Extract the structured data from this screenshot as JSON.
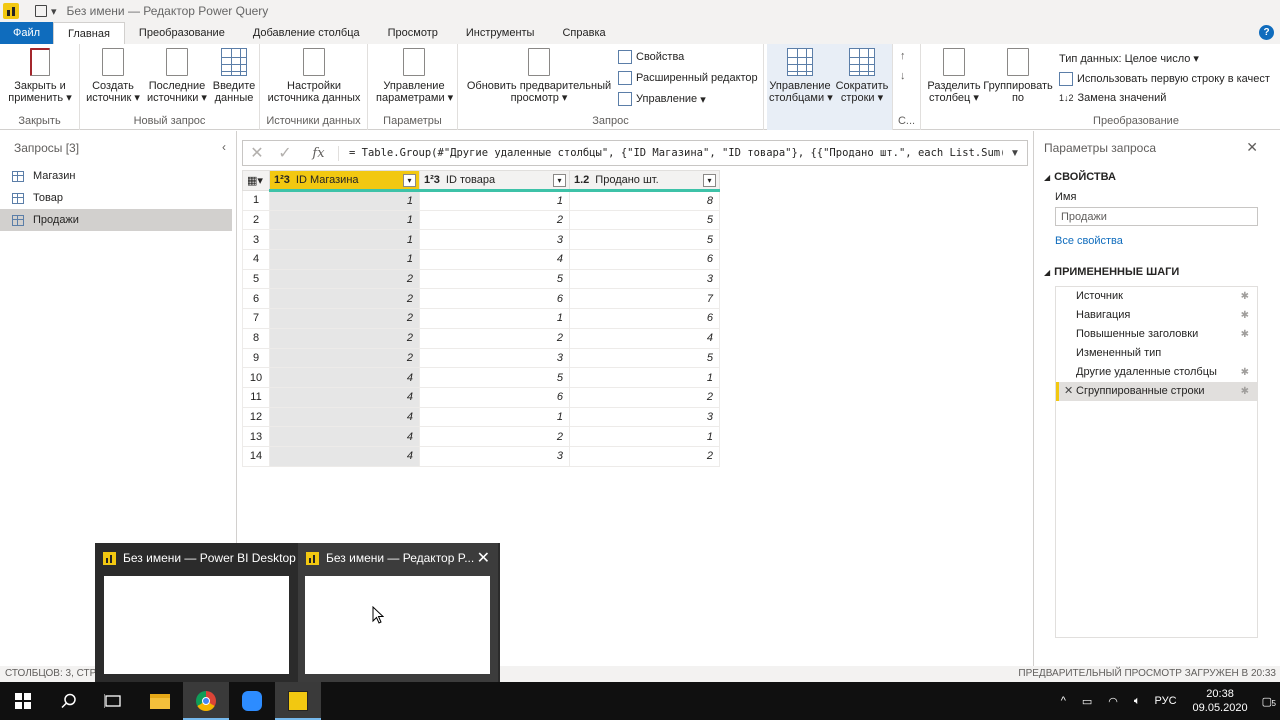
{
  "window": {
    "title": "Без имени — Редактор Power Query"
  },
  "tabs": [
    {
      "label": "Файл"
    },
    {
      "label": "Главная"
    },
    {
      "label": "Преобразование"
    },
    {
      "label": "Добавление столбца"
    },
    {
      "label": "Просмотр"
    },
    {
      "label": "Инструменты"
    },
    {
      "label": "Справка"
    }
  ],
  "ribbon": {
    "close_apply_line1": "Закрыть и",
    "close_apply_line2": "применить",
    "new_source_line1": "Создать",
    "new_source_line2": "источник",
    "recent_sources_line1": "Последние",
    "recent_sources_line2": "источники",
    "enter_data_line1": "Введите",
    "enter_data_line2": "данные",
    "ds_settings_line1": "Настройки",
    "ds_settings_line2": "источника данных",
    "manage_params_line1": "Управление",
    "manage_params_line2": "параметрами",
    "refresh_preview_line1": "Обновить предварительный",
    "refresh_preview_line2": "просмотр",
    "properties": "Свойства",
    "advanced_editor": "Расширенный редактор",
    "manage": "Управление",
    "manage_columns_line1": "Управление",
    "manage_columns_line2": "столбцами",
    "reduce_rows_line1": "Сократить",
    "reduce_rows_line2": "строки",
    "split_column_line1": "Разделить",
    "split_column_line2": "столбец",
    "group_by_line1": "Группировать",
    "group_by_line2": "по",
    "data_type": "Тип данных: Целое число",
    "first_row_headers": "Использовать первую строку в качест",
    "replace_values": "Замена значений",
    "groups": {
      "close": "Закрыть",
      "new_query": "Новый запрос",
      "data_sources": "Источники данных",
      "parameters": "Параметры",
      "query": "Запрос",
      "sort": "С...",
      "transform": "Преобразование"
    }
  },
  "queries": {
    "header": "Запросы [3]",
    "items": [
      {
        "name": "Магазин"
      },
      {
        "name": "Товар"
      },
      {
        "name": "Продажи"
      }
    ]
  },
  "formula": {
    "text": "= Table.Group(#\"Другие удаленные столбцы\", {\"ID Магазина\", \"ID товара\"}, {{\"Продано шт.\", each List.Sum("
  },
  "table": {
    "columns": [
      {
        "type": "1²3",
        "name": "ID Магазина"
      },
      {
        "type": "1²3",
        "name": "ID товара"
      },
      {
        "type": "1.2",
        "name": "Продано шт."
      }
    ],
    "rows": [
      [
        "1",
        "1",
        "1",
        "8"
      ],
      [
        "2",
        "1",
        "2",
        "5"
      ],
      [
        "3",
        "1",
        "3",
        "5"
      ],
      [
        "4",
        "1",
        "4",
        "6"
      ],
      [
        "5",
        "2",
        "5",
        "3"
      ],
      [
        "6",
        "2",
        "6",
        "7"
      ],
      [
        "7",
        "2",
        "1",
        "6"
      ],
      [
        "8",
        "2",
        "2",
        "4"
      ],
      [
        "9",
        "2",
        "3",
        "5"
      ],
      [
        "10",
        "4",
        "5",
        "1"
      ],
      [
        "11",
        "4",
        "6",
        "2"
      ],
      [
        "12",
        "4",
        "1",
        "3"
      ],
      [
        "13",
        "4",
        "2",
        "1"
      ],
      [
        "14",
        "4",
        "3",
        "2"
      ]
    ]
  },
  "settings": {
    "title": "Параметры запроса",
    "properties_header": "СВОЙСТВА",
    "name_label": "Имя",
    "name_value": "Продажи",
    "all_properties": "Все свойства",
    "steps_header": "ПРИМЕНЕННЫЕ ШАГИ",
    "steps": [
      {
        "name": "Источник"
      },
      {
        "name": "Навигация"
      },
      {
        "name": "Повышенные заголовки"
      },
      {
        "name": "Измененный тип"
      },
      {
        "name": "Другие удаленные столбцы"
      },
      {
        "name": "Сгруппированные строки"
      }
    ]
  },
  "status": {
    "left": "СТОЛБЦОВ: 3, СТР",
    "right": "ПРЕДВАРИТЕЛЬНЫЙ ПРОСМОТР ЗАГРУЖЕН В 20:33"
  },
  "popup": {
    "thumb1_title": "Без имени — Power BI Desktop",
    "thumb2_title": "Без имени — Редактор P..."
  },
  "taskbar": {
    "lang": "РУС",
    "time": "20:38",
    "date": "09.05.2020",
    "notif_count": "5"
  }
}
